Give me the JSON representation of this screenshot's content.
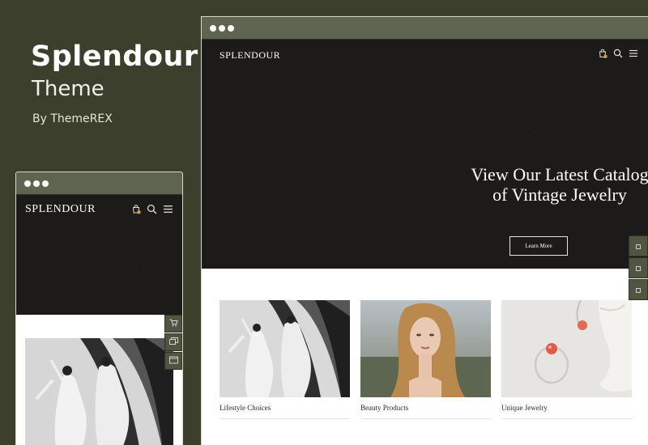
{
  "hero": {
    "title": "Splendour",
    "subtitle": "Theme",
    "byline": "By ThemeREX"
  },
  "desktop": {
    "logo": "SPLENDOUR",
    "cart_count": "0",
    "ghost_text": "· · · ·",
    "headline_line1": "View Our Latest Catalog",
    "headline_line2": "of Vintage Jewelry",
    "cta_label": "Learn More",
    "cards": [
      {
        "caption": "Lifestyle Choices"
      },
      {
        "caption": "Beauty Products"
      },
      {
        "caption": "Unique Jewelry"
      }
    ]
  },
  "mobile": {
    "logo": "SPLENDOUR",
    "cart_count": "0",
    "ghost_text": "· · ·"
  },
  "colors": {
    "background": "#3b3f2b",
    "titlebar": "#5e6450",
    "header_dark": "#1c1b19",
    "side_tab": "#4f5541"
  }
}
